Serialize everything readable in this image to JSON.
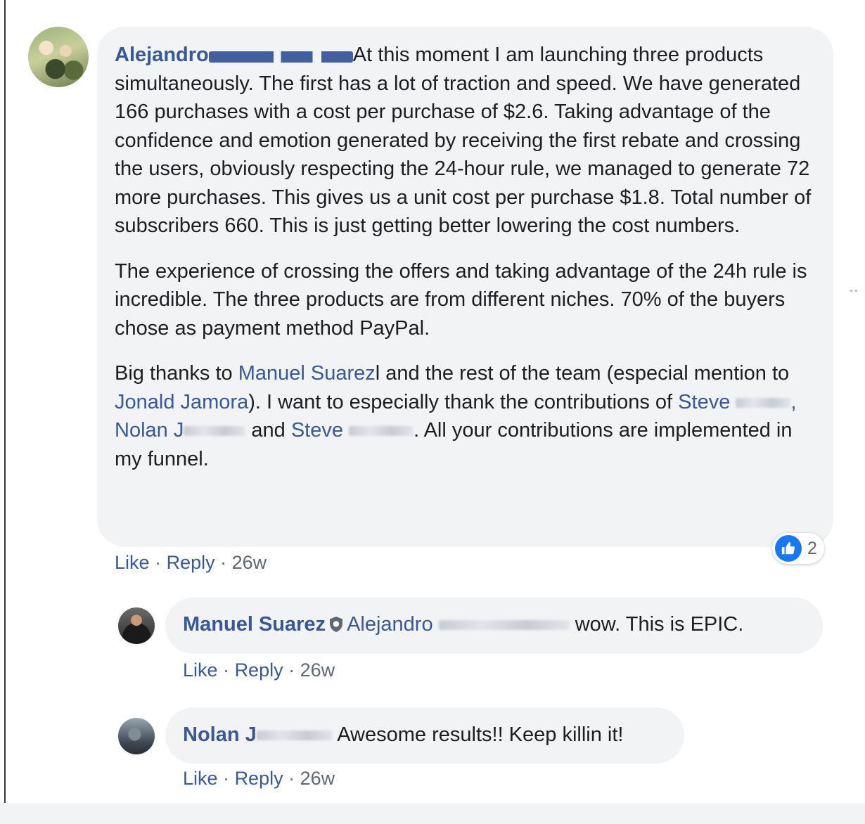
{
  "comment": {
    "author": "Alejandro",
    "paragraphs": [
      "At this moment I am launching three products simultaneously. The first has a lot of traction and speed. We have generated 166 purchases with a cost per purchase of $2.6. Taking advantage of the confidence and emotion generated by receiving the first rebate and crossing the users, obviously respecting the 24-hour rule, we managed to generate 72 more purchases. This gives us a unit cost per purchase $1.8. Total number of subscribers 660. This is just getting better lowering the cost numbers.",
      "The experience of crossing the offers and taking advantage of the 24h rule is incredible. The three products are from different niches. 70% of the buyers chose as payment method PayPal."
    ],
    "p3": {
      "t1": "Big thanks to ",
      "m1": "Manuel Suarez",
      "t2": "l and the rest of the team (especial mention to ",
      "m2": "Jonald Jamora",
      "t3": "). I want to especially thank the contributions of ",
      "m3": "Steve",
      "m3_tail": ",",
      "m4": "Nolan",
      "m4_tail": "J",
      "t4": " and ",
      "m5": "Steve",
      "t5": ". All your contributions are implemented in my funnel."
    },
    "actions": {
      "like": "Like",
      "reply": "Reply",
      "time": "26w"
    },
    "reaction_count": "2",
    "reaction_icon": "like-thumb-icon",
    "accent_color": "#385898"
  },
  "replies": [
    {
      "author": "Manuel Suarez",
      "mention": "Alejandro",
      "text": "wow. This is EPIC.",
      "actions": {
        "like": "Like",
        "reply": "Reply",
        "time": "26w"
      }
    },
    {
      "author": "Nolan",
      "author_tail": "J",
      "text": "Awesome results!! Keep killin it!",
      "actions": {
        "like": "Like",
        "reply": "Reply",
        "time": "26w"
      }
    }
  ],
  "options_glyph": "••"
}
